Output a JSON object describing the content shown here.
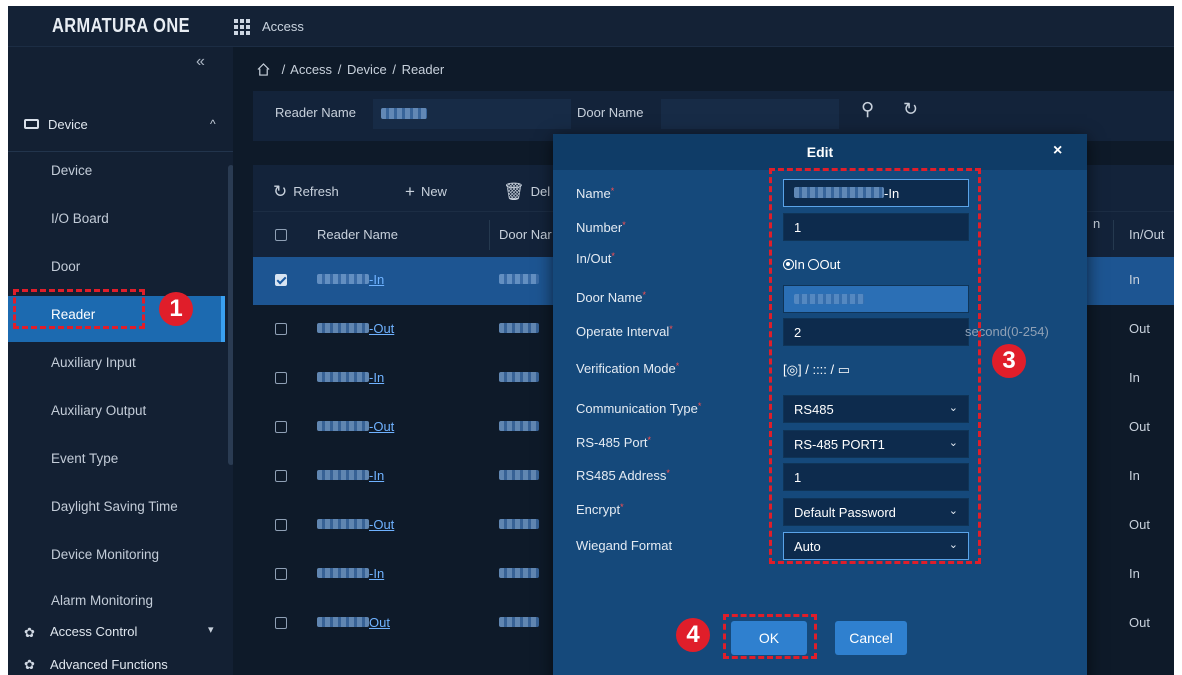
{
  "app": {
    "logo": "ARMATURA ONE",
    "module": "Access"
  },
  "sidebar": {
    "collapse_glyph": "«",
    "section": "Device",
    "items": [
      {
        "label": "Device"
      },
      {
        "label": "I/O Board"
      },
      {
        "label": "Door"
      },
      {
        "label": "Reader"
      },
      {
        "label": "Auxiliary Input"
      },
      {
        "label": "Auxiliary Output"
      },
      {
        "label": "Event Type"
      },
      {
        "label": "Daylight Saving Time"
      },
      {
        "label": "Device Monitoring"
      },
      {
        "label": "Alarm Monitoring"
      }
    ],
    "active_item": "Reader",
    "access_control": "Access Control",
    "advanced_functions": "Advanced Functions"
  },
  "breadcrumb": {
    "items": [
      "Access",
      "Device",
      "Reader"
    ],
    "separator": "/"
  },
  "filter": {
    "reader_name_label": "Reader Name",
    "door_name_label": "Door Name"
  },
  "toolbar": {
    "refresh": "Refresh",
    "new": "New",
    "delete": "Del"
  },
  "table": {
    "headers": {
      "reader_name": "Reader Name",
      "door_name": "Door Nar",
      "partial": "n",
      "in_out": "In/Out"
    },
    "rows": [
      {
        "name_suffix": "-In",
        "in_out": "In",
        "checked": true
      },
      {
        "name_suffix": "-Out",
        "in_out": "Out",
        "checked": false
      },
      {
        "name_suffix": "-In",
        "in_out": "In",
        "checked": false
      },
      {
        "name_suffix": "-Out",
        "in_out": "Out",
        "checked": false
      },
      {
        "name_suffix": "-In",
        "in_out": "In",
        "checked": false
      },
      {
        "name_suffix": "-Out",
        "in_out": "Out",
        "checked": false
      },
      {
        "name_suffix": "-In",
        "in_out": "In",
        "checked": false
      },
      {
        "name_suffix": "Out",
        "in_out": "Out",
        "checked": false
      }
    ]
  },
  "dialog": {
    "title": "Edit",
    "close": "×",
    "labels": {
      "name": "Name",
      "number": "Number",
      "in_out": "In/Out",
      "door_name": "Door Name",
      "operate_interval": "Operate Interval",
      "verification_mode": "Verification Mode",
      "communication_type": "Communication Type",
      "rs485_port": "RS-485 Port",
      "rs485_address": "RS485 Address",
      "encrypt": "Encrypt",
      "wiegand_format": "Wiegand Format"
    },
    "required_mark": "*",
    "values": {
      "name_suffix": "-In",
      "number": "1",
      "in_option": "In",
      "out_option": "Out",
      "operate_interval": "2",
      "operate_interval_unit": "second(0-254)",
      "verification_mode_sep": "/",
      "pin_glyph": "::::",
      "communication_type": "RS485",
      "rs485_port": "RS-485 PORT1",
      "rs485_address": "1",
      "encrypt": "Default Password",
      "wiegand_format": "Auto"
    },
    "ok": "OK",
    "cancel": "Cancel"
  },
  "annotations": {
    "one": "1",
    "three": "3",
    "four": "4",
    "color": "#e01e2a"
  }
}
